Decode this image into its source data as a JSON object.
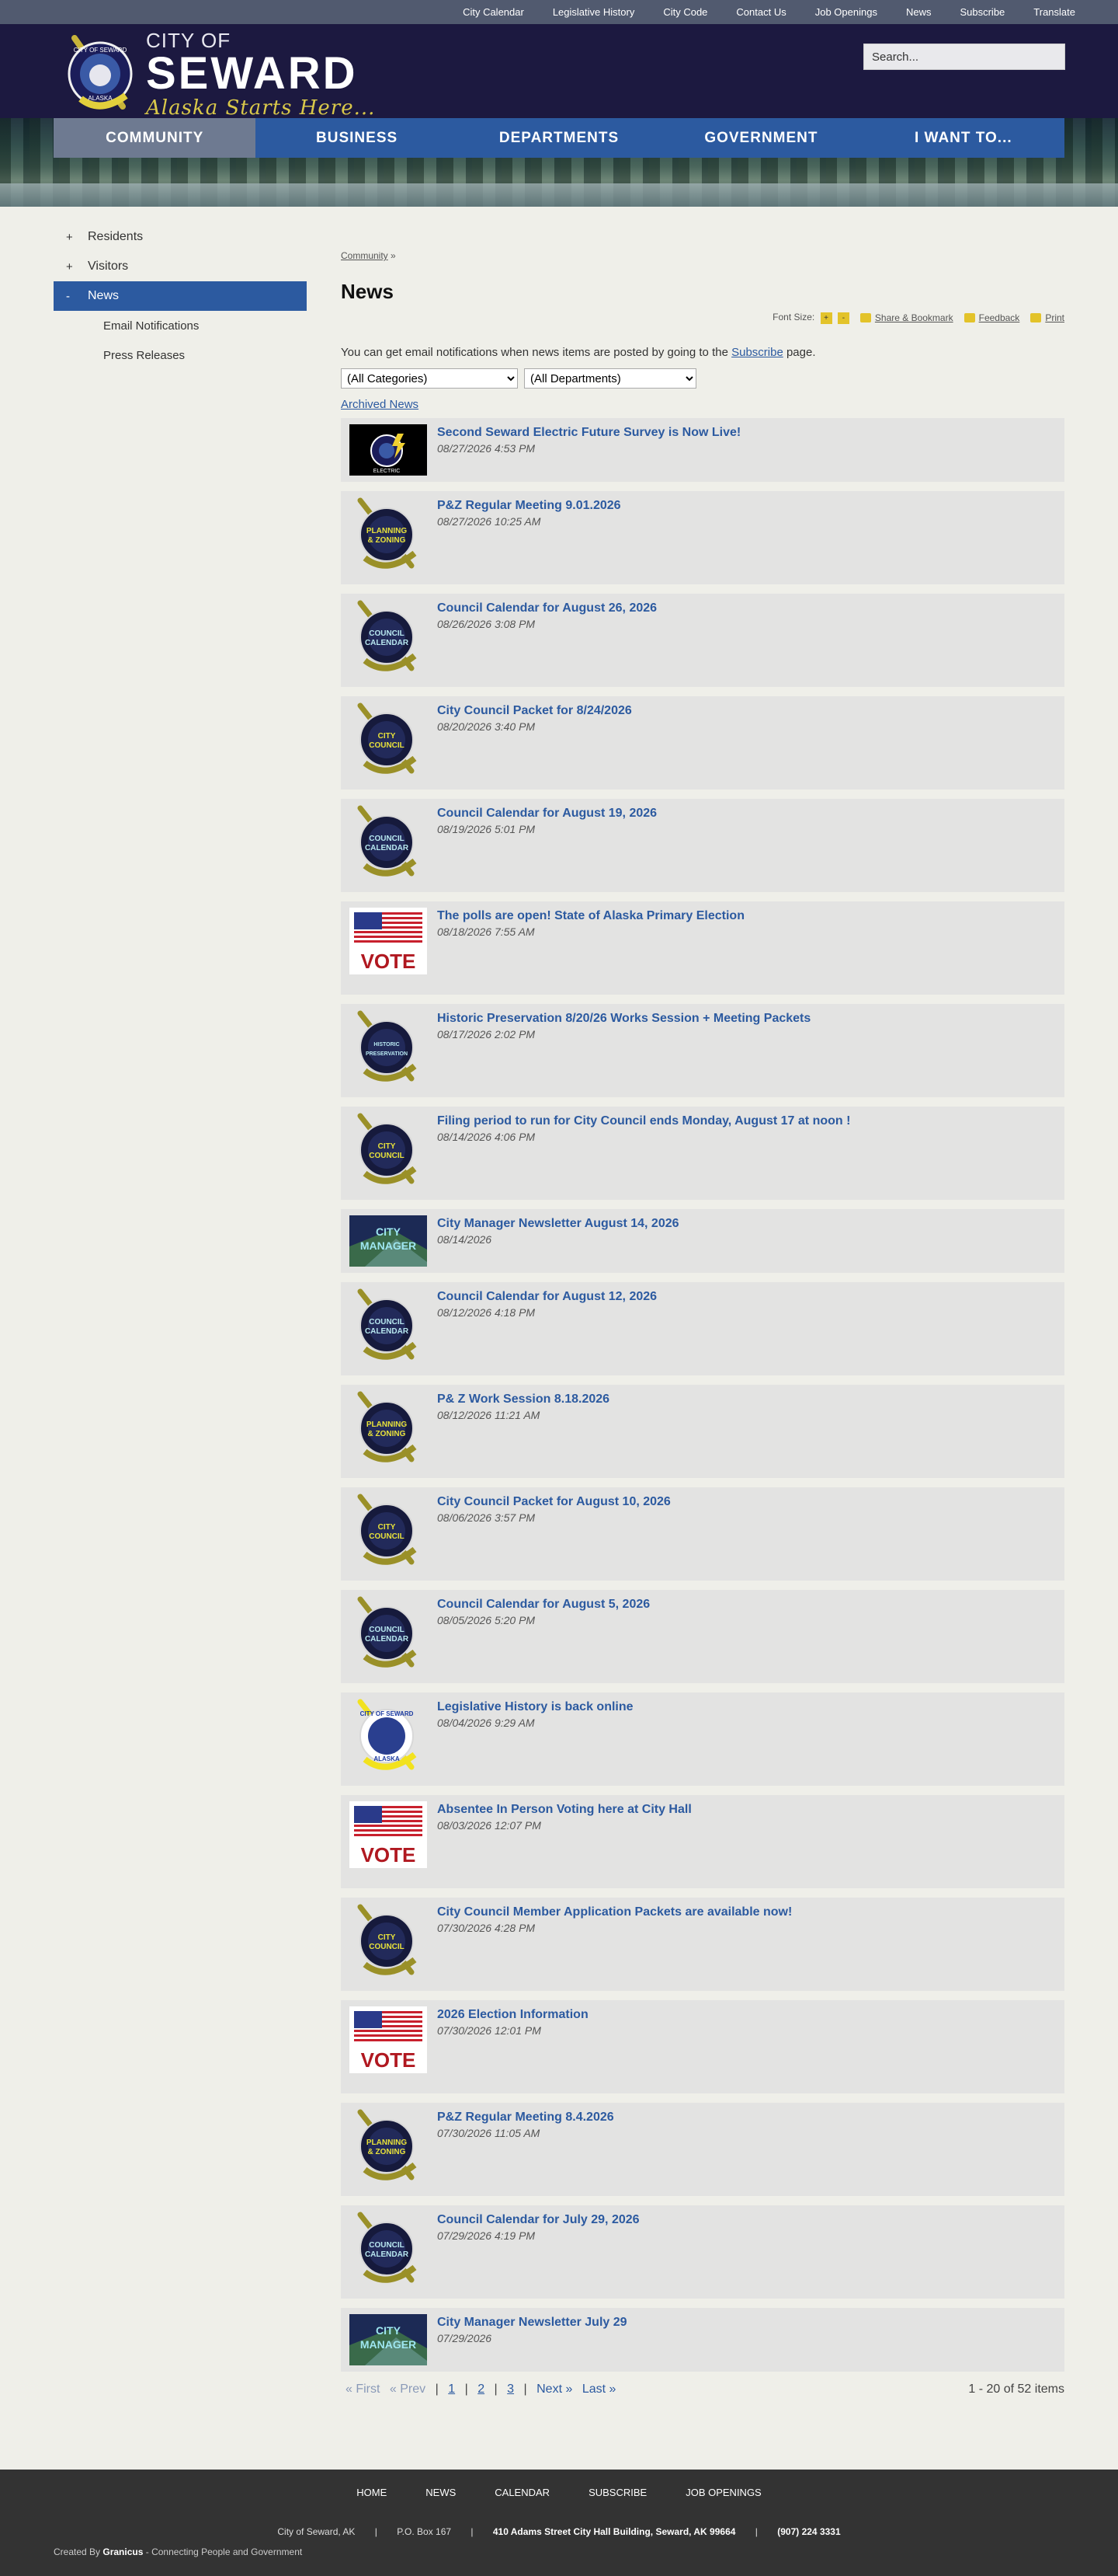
{
  "topbar": [
    "City Calendar",
    "Legislative History",
    "City Code",
    "Contact Us",
    "Job Openings",
    "News",
    "Subscribe",
    "Translate"
  ],
  "brand": {
    "city_of": "CITY OF",
    "name": "SEWARD",
    "tagline": "Alaska Starts Here...",
    "logo_ring": "CITY OF SEWARD",
    "logo_bottom": "ALASKA"
  },
  "search": {
    "placeholder": "Search..."
  },
  "nav": [
    "COMMUNITY",
    "BUSINESS",
    "DEPARTMENTS",
    "GOVERNMENT",
    "I WANT TO..."
  ],
  "sidebar": {
    "items": [
      {
        "sign": "+",
        "label": "Residents"
      },
      {
        "sign": "+",
        "label": "Visitors"
      },
      {
        "sign": "-",
        "label": "News"
      }
    ],
    "sub": [
      "Email Notifications",
      "Press Releases"
    ]
  },
  "breadcrumb": {
    "link": "Community",
    "sep": "»"
  },
  "page_title": "News",
  "tools": {
    "font_size": "Font Size:",
    "increase": "+",
    "decrease": "-",
    "share": "Share & Bookmark",
    "feedback": "Feedback",
    "print": "Print"
  },
  "intro": {
    "before": "You can get email notifications when news items are posted by going to the",
    "link": "Subscribe",
    "after": "page."
  },
  "filters": {
    "categories": "(All Categories)",
    "departments": "(All Departments)"
  },
  "archived": "Archived News",
  "news": [
    {
      "title": "Second Seward Electric Future Survey is Now Live!",
      "date": "08/27/2026 4:53 PM",
      "thumb": "electric"
    },
    {
      "title": "P&Z Regular Meeting 9.01.2026",
      "date": "08/27/2026 10:25 AM",
      "thumb": "planning"
    },
    {
      "title": "Council Calendar for August 26, 2026",
      "date": "08/26/2026 3:08 PM",
      "thumb": "calendar"
    },
    {
      "title": "City Council Packet for 8/24/2026",
      "date": "08/20/2026 3:40 PM",
      "thumb": "council"
    },
    {
      "title": "Council Calendar for August 19, 2026",
      "date": "08/19/2026 5:01 PM",
      "thumb": "calendar"
    },
    {
      "title": "The polls are open! State of Alaska Primary Election",
      "date": "08/18/2026 7:55 AM",
      "thumb": "vote"
    },
    {
      "title": "Historic Preservation 8/20/26 Works Session + Meeting Packets",
      "date": "08/17/2026 2:02 PM",
      "thumb": "historic"
    },
    {
      "title": "Filing period to run for City Council ends Monday, August 17 at noon !",
      "date": "08/14/2026 4:06 PM",
      "thumb": "council"
    },
    {
      "title": "City Manager Newsletter August 14, 2026",
      "date": "08/14/2026",
      "thumb": "manager"
    },
    {
      "title": "Council Calendar for August 12, 2026",
      "date": "08/12/2026 4:18 PM",
      "thumb": "calendar"
    },
    {
      "title": "P& Z Work Session 8.18.2026",
      "date": "08/12/2026 11:21 AM",
      "thumb": "planning"
    },
    {
      "title": "City Council Packet for August 10, 2026",
      "date": "08/06/2026 3:57 PM",
      "thumb": "council"
    },
    {
      "title": "Council Calendar for August 5, 2026",
      "date": "08/05/2026 5:20 PM",
      "thumb": "calendar"
    },
    {
      "title": "Legislative History is back online",
      "date": "08/04/2026 9:29 AM",
      "thumb": "seal"
    },
    {
      "title": "Absentee In Person Voting here at City Hall",
      "date": "08/03/2026 12:07 PM",
      "thumb": "vote"
    },
    {
      "title": "City Council Member Application Packets are available now!",
      "date": "07/30/2026 4:28 PM",
      "thumb": "council"
    },
    {
      "title": "2026 Election Information",
      "date": "07/30/2026 12:01 PM",
      "thumb": "vote"
    },
    {
      "title": "P&Z Regular Meeting 8.4.2026",
      "date": "07/30/2026 11:05 AM",
      "thumb": "planning"
    },
    {
      "title": "Council Calendar for July 29, 2026",
      "date": "07/29/2026 4:19 PM",
      "thumb": "calendar"
    },
    {
      "title": "City Manager Newsletter July 29",
      "date": "07/29/2026",
      "thumb": "manager"
    }
  ],
  "thumb_text": {
    "planning": [
      "PLANNING",
      "& ZONING"
    ],
    "calendar": [
      "COUNCIL",
      "CALENDAR"
    ],
    "council": [
      "CITY",
      "COUNCIL"
    ],
    "historic": [
      "HISTORIC",
      "PRESERVATION"
    ],
    "seal": [
      "CITY OF SEWARD",
      "ALASKA"
    ],
    "electric": [
      "CITY OF SEWARD",
      "ELECTRIC"
    ],
    "manager": [
      "CITY",
      "MANAGER"
    ],
    "vote": [
      "VOTE"
    ]
  },
  "pager": {
    "first": "« First",
    "prev": "« Prev",
    "sep": "|",
    "pages": [
      "1",
      "2",
      "3"
    ],
    "next": "Next »",
    "last": "Last »",
    "summary": "1 - 20 of 52 items"
  },
  "footer": {
    "nav": [
      "HOME",
      "NEWS",
      "CALENDAR",
      "SUBSCRIBE",
      "JOB OPENINGS"
    ],
    "city": "City of Seward, AK",
    "po": "P.O. Box 167",
    "address": "410 Adams Street City Hall Building, Seward, AK 99664",
    "phone": "(907) 224 3331",
    "credit_prefix": "Created By",
    "credit_brand": "Granicus",
    "credit_suffix": "- Connecting People and Government"
  },
  "colors": {
    "nav_blue": "#2c5aa0",
    "nav_active": "#6e7a91",
    "header": "#1c1940",
    "link": "#2c5aa0",
    "gold": "#d9c84a"
  }
}
